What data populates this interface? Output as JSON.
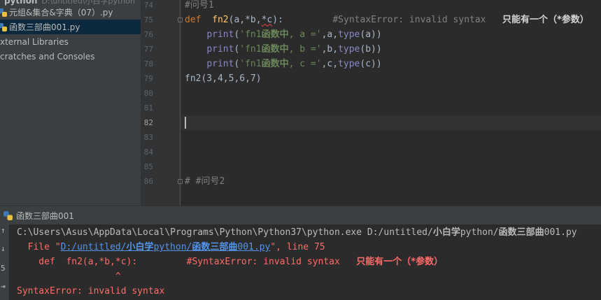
{
  "project_tree": {
    "items": [
      {
        "label": "元组&集合&字典（07）.py",
        "selected": false
      },
      {
        "label": "函数三部曲001.py",
        "selected": true
      },
      {
        "label": "xternal Libraries",
        "selected": false
      },
      {
        "label": "cratches and Consoles",
        "selected": false
      }
    ],
    "top_partial": "python",
    "top_partial_hint": "D:\\untitled\\小白学python"
  },
  "editor": {
    "lines": [
      {
        "no": "74",
        "text": "#问号1"
      },
      {
        "no": "75",
        "kw": "def",
        "fn": "fn2",
        "params_pre": "(a,*b,",
        "params_err": "*c",
        "params_post": "):",
        "comment": "#SyntaxError: invalid syntax",
        "note": "只能有一个（*参数）"
      },
      {
        "no": "76",
        "call": "print",
        "str_open": "'fn1",
        "str_cn": "函数中",
        "str_rest": ", a ='",
        "args_pre": ",a,",
        "builtin": "type",
        "args_post": "(a))"
      },
      {
        "no": "77",
        "call": "print",
        "str_open": "'fn1",
        "str_cn": "函数中",
        "str_rest": ", b ='",
        "args_pre": ",b,",
        "builtin": "type",
        "args_post": "(b))"
      },
      {
        "no": "78",
        "call": "print",
        "str_open": "'fn1",
        "str_cn": "函数中",
        "str_rest": ", c ='",
        "args_pre": ",c,",
        "builtin": "type",
        "args_post": "(c))"
      },
      {
        "no": "79",
        "text": "fn2(3,4,5,6,7)"
      },
      {
        "no": "80",
        "text": ""
      },
      {
        "no": "81",
        "text": ""
      },
      {
        "no": "82",
        "text": ""
      },
      {
        "no": "83",
        "text": ""
      },
      {
        "no": "84",
        "text": ""
      },
      {
        "no": "85",
        "text": ""
      },
      {
        "no": "86",
        "text": "# #问号2"
      }
    ],
    "current_line": "82"
  },
  "run_panel": {
    "tab_label": "函数三部曲001",
    "console": {
      "cmd_path": "C:\\Users\\Asus\\AppData\\Local\\Programs\\Python\\Python37\\python.exe D:/untitled/",
      "cmd_cn1": "小白学",
      "cmd_mid": "python/",
      "cmd_cn2": "函数三部曲",
      "cmd_end": "001.py",
      "file_prefix": "  File \"",
      "file_link_pre": "D:/untitled/",
      "file_link_cn1": "小白学",
      "file_link_mid": "python/",
      "file_link_cn2": "函数三部曲",
      "file_link_end": "001.py",
      "file_suffix": "\", line 75",
      "err_code": "    def  fn2(a,*b,*c):         #SyntaxError: invalid syntax   ",
      "err_note": "只能有一个（*参数）",
      "caret": "                  ^",
      "error": "SyntaxError: invalid syntax"
    },
    "gutter_glyphs": [
      "↑",
      "↓",
      "5",
      "⇥"
    ]
  },
  "colors": {
    "keyword": "#cc7832",
    "function": "#ffc66d",
    "string": "#6a8759",
    "comment": "#808080",
    "error": "#ff6b68",
    "link": "#5394ec"
  }
}
